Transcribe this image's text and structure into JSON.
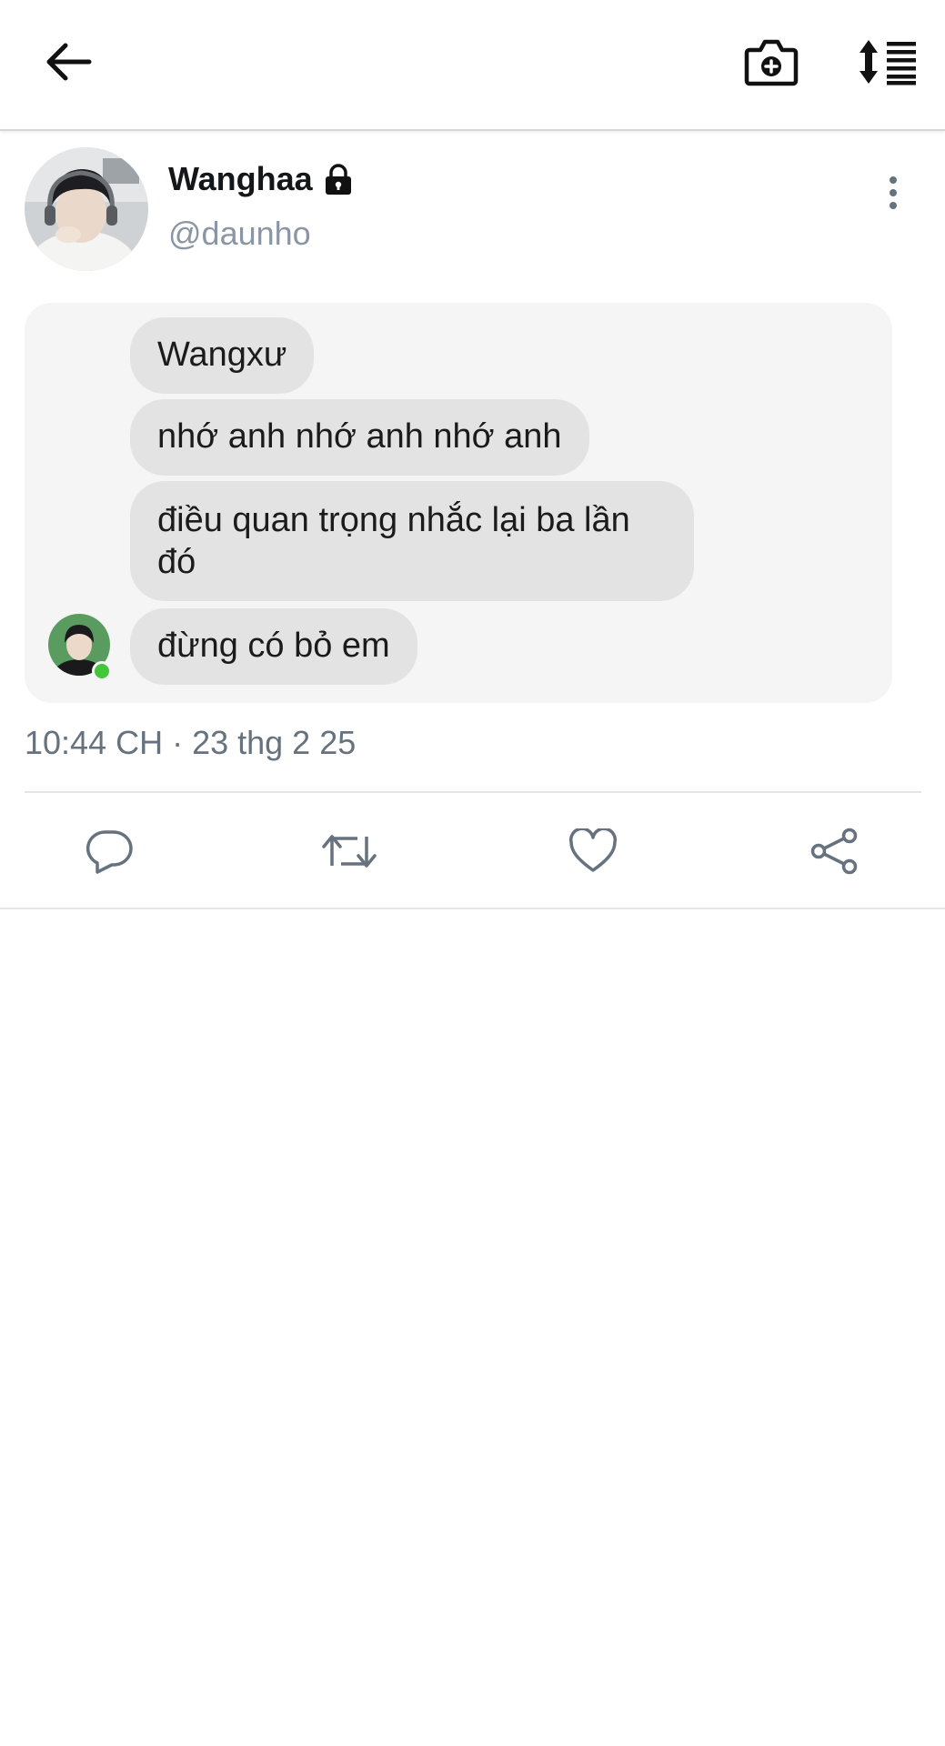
{
  "post": {
    "display_name": "Wanghaa",
    "handle": "@daunho",
    "timestamp": "10:44 CH · 23 thg 2 25",
    "image": {
      "messages": [
        "Wangxư",
        "nhớ anh nhớ anh nhớ anh",
        "điều quan trọng nhắc lại ba lần đó",
        "đừng có bỏ em"
      ]
    }
  },
  "icons": {
    "back": "arrow-left-icon",
    "camera": "camera-add-icon",
    "sort": "sort-lines-icon",
    "lock": "lock-icon",
    "more": "more-vertical-icon",
    "reply": "reply-bubble-icon",
    "retweet": "retweet-icon",
    "like": "heart-icon",
    "share": "share-icon"
  },
  "colors": {
    "handle": "#8a96a3",
    "bubble": "#e3e3e3",
    "media_background": "#f5f5f5",
    "online": "#44c63b"
  }
}
